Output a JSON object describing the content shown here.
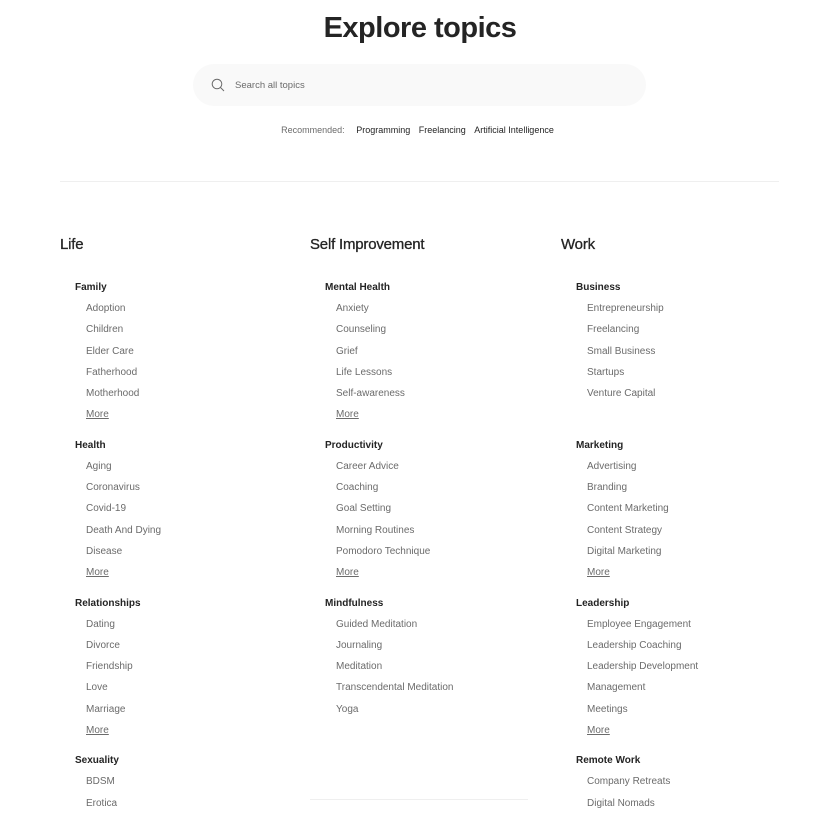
{
  "header": {
    "title": "Explore topics",
    "search_placeholder": "Search all topics",
    "recommended_label": "Recommended:",
    "recommended": [
      "Programming",
      "Freelancing",
      "Artificial Intelligence"
    ]
  },
  "colors": {
    "text_primary": "#242424",
    "text_secondary": "#6b6b6b",
    "search_bg": "#f9f9f9",
    "divider": "#efefef"
  },
  "columns": [
    {
      "title": "Life",
      "groups": [
        {
          "title": "Family",
          "topics": [
            "Adoption",
            "Children",
            "Elder Care",
            "Fatherhood",
            "Motherhood"
          ],
          "more": "More"
        },
        {
          "title": "Health",
          "topics": [
            "Aging",
            "Coronavirus",
            "Covid-19",
            "Death And Dying",
            "Disease"
          ],
          "more": "More"
        },
        {
          "title": "Relationships",
          "topics": [
            "Dating",
            "Divorce",
            "Friendship",
            "Love",
            "Marriage"
          ],
          "more": "More"
        },
        {
          "title": "Sexuality",
          "topics": [
            "BDSM",
            "Erotica"
          ],
          "more": null
        }
      ]
    },
    {
      "title": "Self Improvement",
      "groups": [
        {
          "title": "Mental Health",
          "topics": [
            "Anxiety",
            "Counseling",
            "Grief",
            "Life Lessons",
            "Self-awareness"
          ],
          "more": "More"
        },
        {
          "title": "Productivity",
          "topics": [
            "Career Advice",
            "Coaching",
            "Goal Setting",
            "Morning Routines",
            "Pomodoro Technique"
          ],
          "more": "More"
        },
        {
          "title": "Mindfulness",
          "topics": [
            "Guided Meditation",
            "Journaling",
            "Meditation",
            "Transcendental Meditation",
            "Yoga"
          ],
          "more": null
        }
      ]
    },
    {
      "title": "Work",
      "groups": [
        {
          "title": "Business",
          "topics": [
            "Entrepreneurship",
            "Freelancing",
            "Small Business",
            "Startups",
            "Venture Capital"
          ],
          "more": null
        },
        {
          "title": "Marketing",
          "topics": [
            "Advertising",
            "Branding",
            "Content Marketing",
            "Content Strategy",
            "Digital Marketing"
          ],
          "more": "More"
        },
        {
          "title": "Leadership",
          "topics": [
            "Employee Engagement",
            "Leadership Coaching",
            "Leadership Development",
            "Management",
            "Meetings"
          ],
          "more": "More"
        },
        {
          "title": "Remote Work",
          "topics": [
            "Company Retreats",
            "Digital Nomads"
          ],
          "more": null
        }
      ]
    }
  ]
}
